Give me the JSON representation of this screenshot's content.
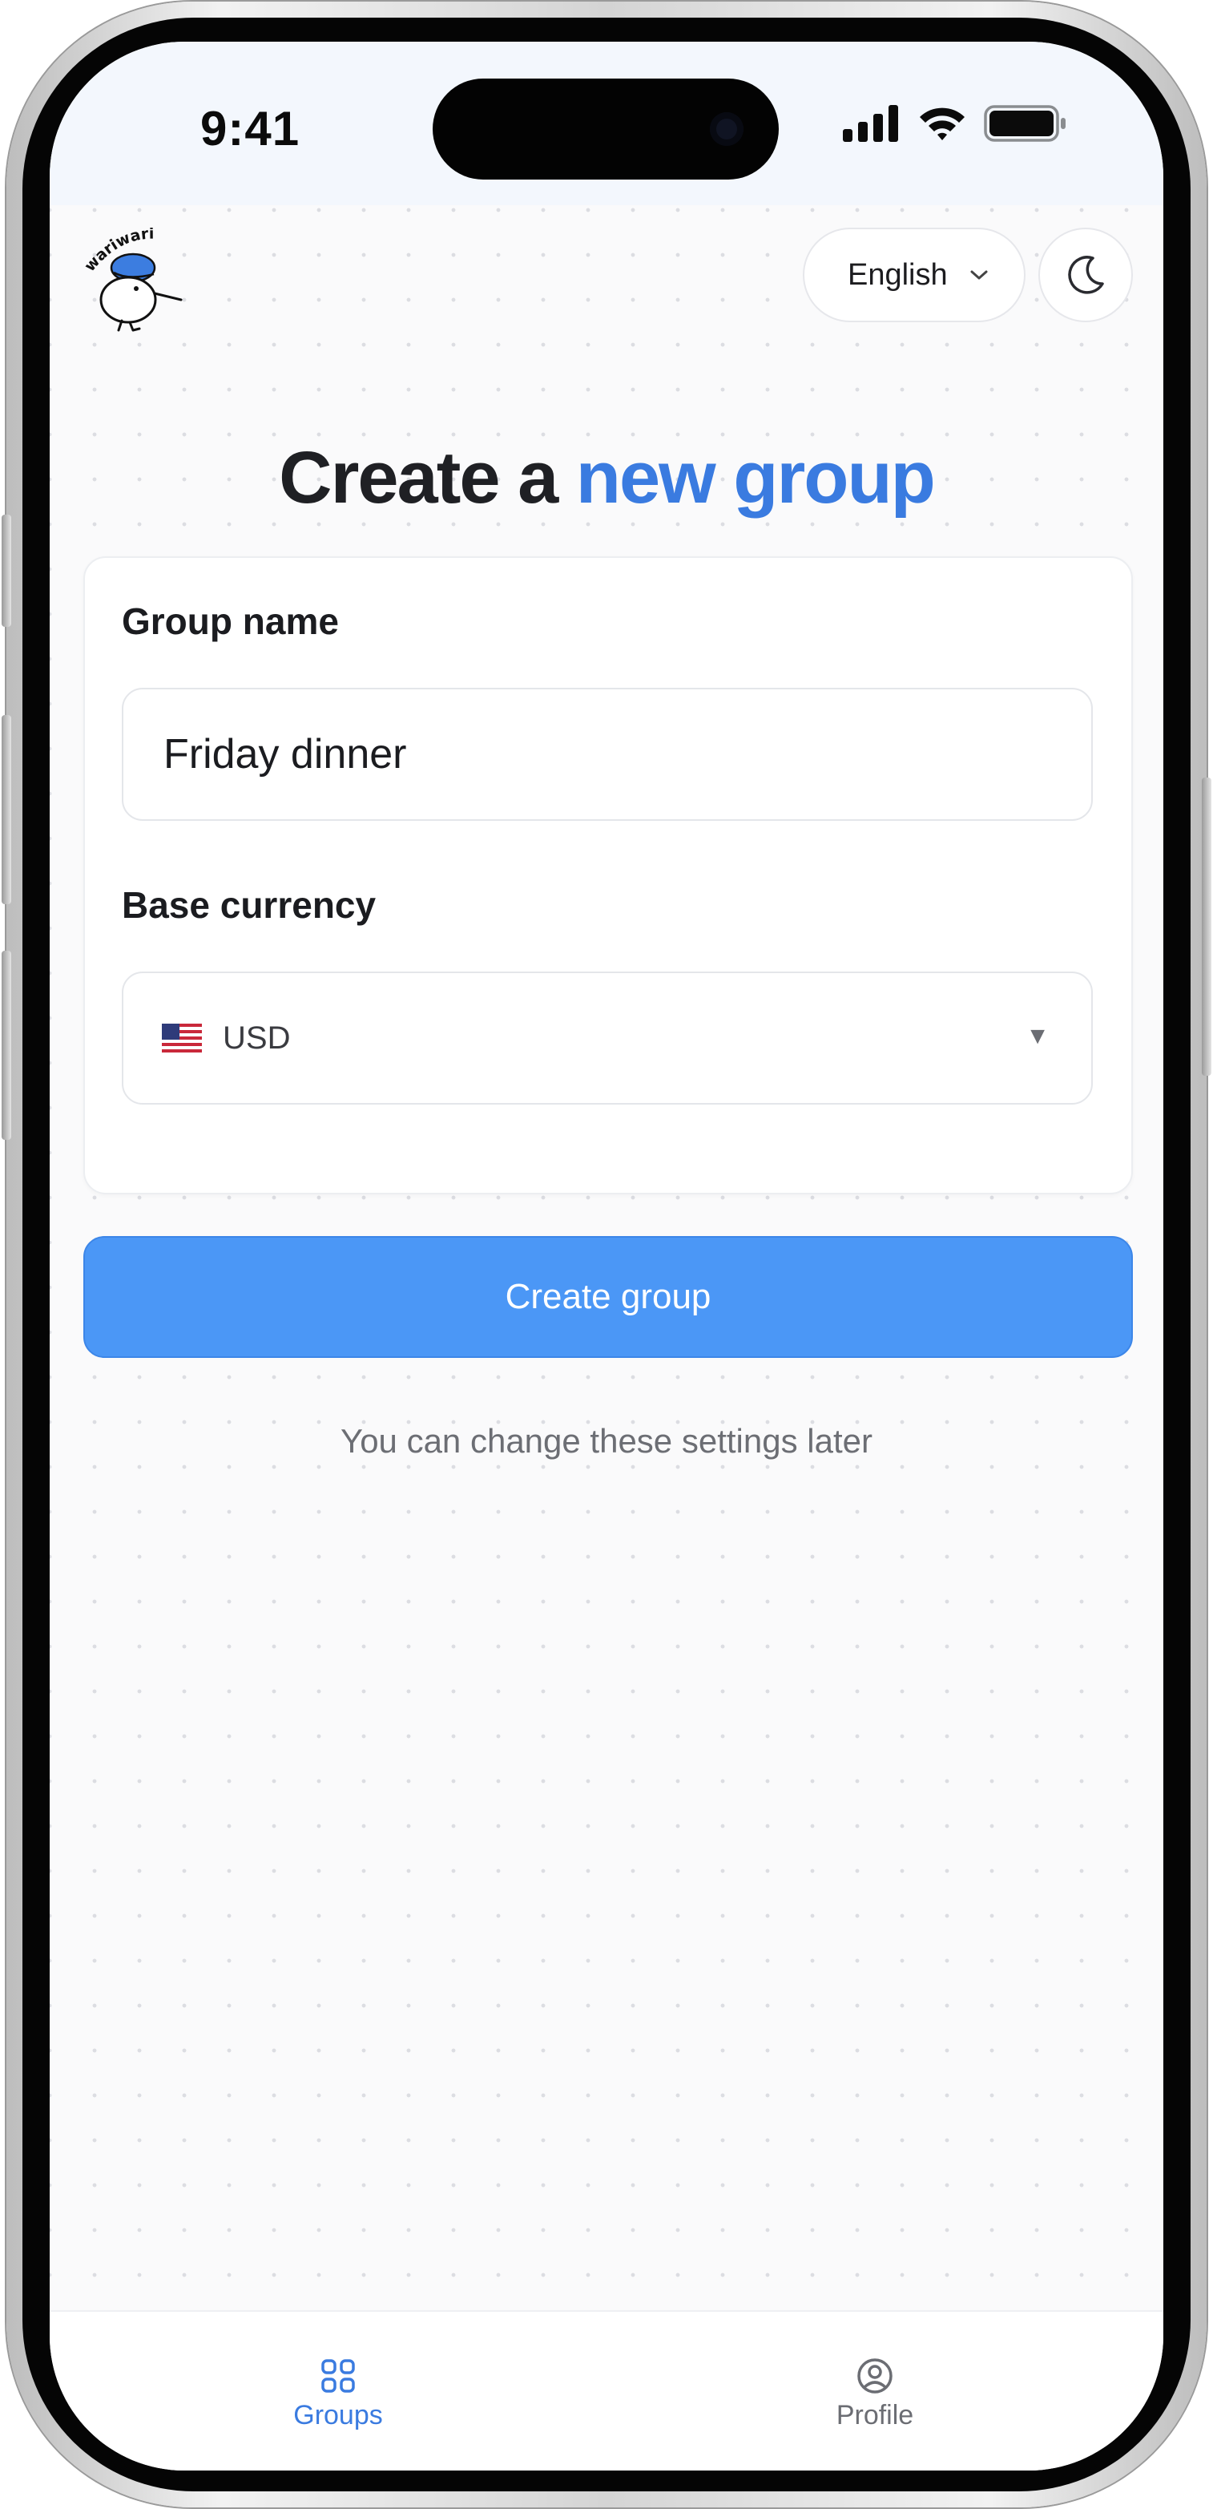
{
  "status_bar": {
    "time": "9:41"
  },
  "header": {
    "logo_text": "wariwari",
    "language": "English"
  },
  "page": {
    "title_prefix": "Create a",
    "title_accent": "new group",
    "accent_color": "#3a7be0"
  },
  "form": {
    "group_name_label": "Group name",
    "group_name_value": "Friday dinner",
    "currency_label": "Base currency",
    "currency_value": "USD",
    "currency_arrow": "▼"
  },
  "actions": {
    "create_label": "Create group",
    "button_color": "#4b97f6",
    "hint": "You can change these settings later"
  },
  "nav": {
    "items": [
      {
        "label": "Groups",
        "icon": "grid-icon",
        "active": true
      },
      {
        "label": "Profile",
        "icon": "user-circle-icon",
        "active": false
      }
    ]
  }
}
